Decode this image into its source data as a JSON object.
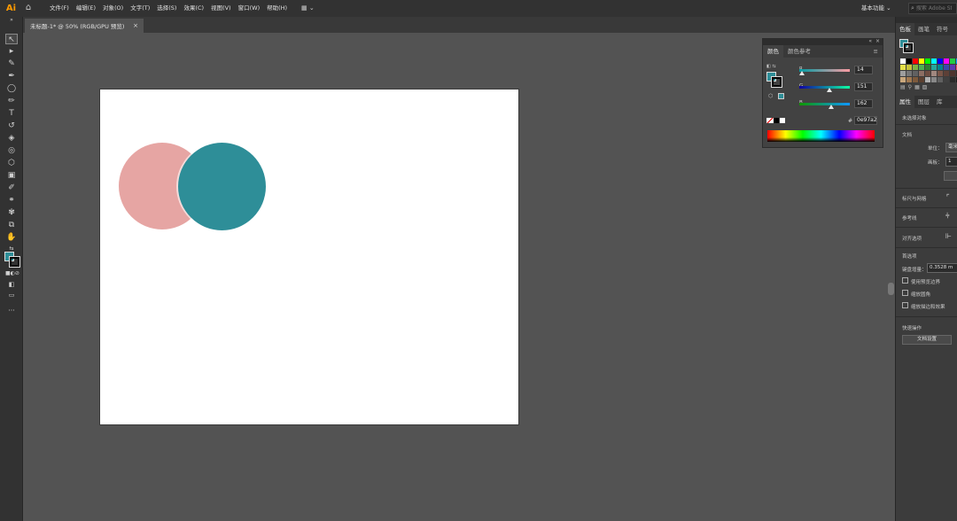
{
  "app": {
    "logo": "Ai",
    "menu": [
      "文件(F)",
      "编辑(E)",
      "对象(O)",
      "文字(T)",
      "选择(S)",
      "效果(C)",
      "视图(V)",
      "窗口(W)",
      "帮助(H)"
    ],
    "workspace": "基本功能",
    "search_placeholder": "搜索 Adobe Stock"
  },
  "document_tab": {
    "title": "未标题-1* @ 50% (RGB/GPU 预览)",
    "close": "×"
  },
  "canvas": {
    "circles": [
      {
        "name": "pink-circle",
        "color": "#e6a5a3"
      },
      {
        "name": "teal-circle",
        "color": "#2e8e98"
      }
    ]
  },
  "color_panel": {
    "tabs": [
      "颜色",
      "颜色参考"
    ],
    "active_tab": "颜色",
    "channels": [
      {
        "label": "R",
        "value": "14",
        "fraction": 0.055
      },
      {
        "label": "G",
        "value": "151",
        "fraction": 0.59
      },
      {
        "label": "B",
        "value": "162",
        "fraction": 0.635
      }
    ],
    "hex_label": "#",
    "hex_value": "0e97a2",
    "fill_color": "#2e8e98"
  },
  "right_panel": {
    "top_tabs": [
      "色板",
      "画笔",
      "符号"
    ],
    "prop_tabs": [
      "属性",
      "图层",
      "库"
    ],
    "no_selection": "未选择对象",
    "document_section": "文档",
    "unit_label": "单位：",
    "unit_value": "毫米",
    "artboard_label": "画板：",
    "artboard_value": "1",
    "rulers_grid": "标尺与网格",
    "guides": "参考线",
    "snap_options": "对齐选项",
    "preferences": "首选项",
    "keyboard_increment_label": "键盘增量：",
    "keyboard_increment_value": "0.3528 m",
    "checks": [
      "使用预览边界",
      "缩放圆角",
      "缩放描边和效果"
    ],
    "quick_actions": "快速操作",
    "doc_setup_button": "文档设置"
  },
  "colors": {
    "pink": "#e6a5a3",
    "teal": "#2e8e98",
    "ui_dark": "#323232",
    "ui_canvas": "#535353"
  }
}
